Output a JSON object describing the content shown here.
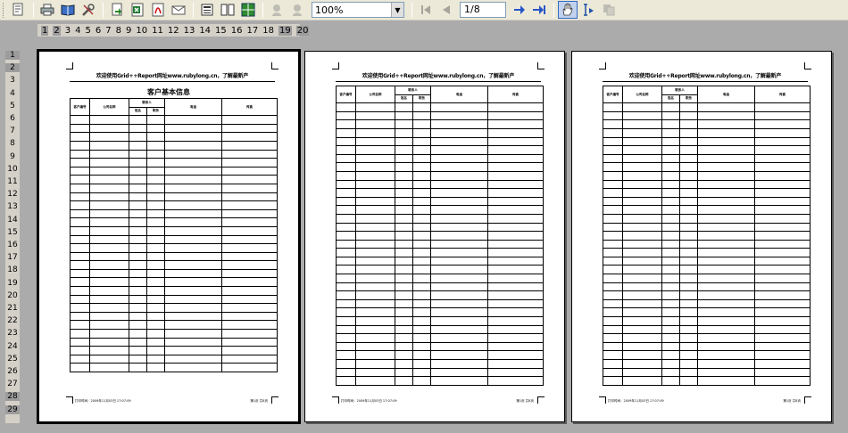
{
  "toolbar": {
    "zoom_value": "100%",
    "page_value": "1/8",
    "icons": [
      "print-setup-icon",
      "print-icon",
      "book-icon",
      "tools-icon",
      "export-icon",
      "excel-icon",
      "pdf-icon",
      "email-icon",
      "single-page-icon",
      "two-page-icon",
      "multi-page-icon",
      "zoom-in-icon",
      "zoom-out-icon",
      "first-page-icon",
      "prev-page-icon",
      "next-page-icon",
      "last-page-icon",
      "hand-tool-icon",
      "text-select-icon",
      "copy-icon"
    ]
  },
  "ruler_h": [
    "1",
    "2",
    "3",
    "4",
    "5",
    "6",
    "7",
    "8",
    "9",
    "10",
    "11",
    "12",
    "13",
    "14",
    "15",
    "16",
    "17",
    "18",
    "19",
    "20"
  ],
  "ruler_v": [
    "1",
    "2",
    "3",
    "4",
    "5",
    "6",
    "7",
    "8",
    "9",
    "10",
    "11",
    "12",
    "13",
    "14",
    "15",
    "16",
    "17",
    "18",
    "19",
    "20",
    "21",
    "22",
    "23",
    "24",
    "25",
    "26",
    "27",
    "28",
    "29"
  ],
  "report": {
    "title": "欢迎使用Grid++Report网址www.rubylong.cn，了解最新产",
    "heading": "客户基本信息",
    "columns": [
      "客户编号",
      "公司名称",
      "联系人",
      "联系方式",
      "电话",
      "传真"
    ],
    "contact_sub": [
      "姓名",
      "职务"
    ],
    "footer_left": "打印时间：2009年11月03日 17:07:09",
    "footer_right": "第1页 共8页"
  }
}
